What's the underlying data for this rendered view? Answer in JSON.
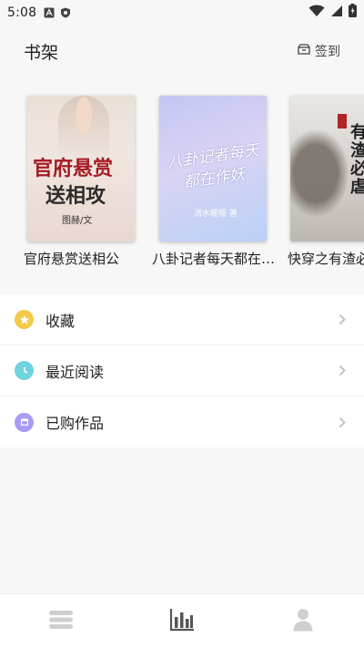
{
  "status_bar": {
    "time": "5:08"
  },
  "header": {
    "title": "书架",
    "checkin_label": "签到"
  },
  "books": [
    {
      "title": "官府悬赏送相公",
      "cover_title_line1": "官府悬赏",
      "cover_title_line2": "送相攻",
      "cover_author": "图赫/文"
    },
    {
      "title": "八卦记者每天都在作妖",
      "cover_title_line1": "八卦记者每天",
      "cover_title_line2": "都在作妖",
      "cover_author": "清水暖暖 著"
    },
    {
      "title": "快穿之有渣必虐",
      "cover_title": "有渣必虐"
    }
  ],
  "menu": {
    "items": [
      {
        "label": "收藏",
        "icon": "star-icon",
        "color": "#f3c94a"
      },
      {
        "label": "最近阅读",
        "icon": "clock-icon",
        "color": "#6fd3df"
      },
      {
        "label": "已购作品",
        "icon": "calendar-icon",
        "color": "#a99cf6"
      }
    ]
  },
  "bottom_nav": {
    "items": [
      {
        "icon": "library-icon",
        "active": false
      },
      {
        "icon": "bar-chart-icon",
        "active": true
      },
      {
        "icon": "profile-icon",
        "active": false
      }
    ]
  },
  "colors": {
    "background": "#f7f7f7",
    "icon_inactive": "#cfcfcf",
    "icon_active": "#555555"
  }
}
